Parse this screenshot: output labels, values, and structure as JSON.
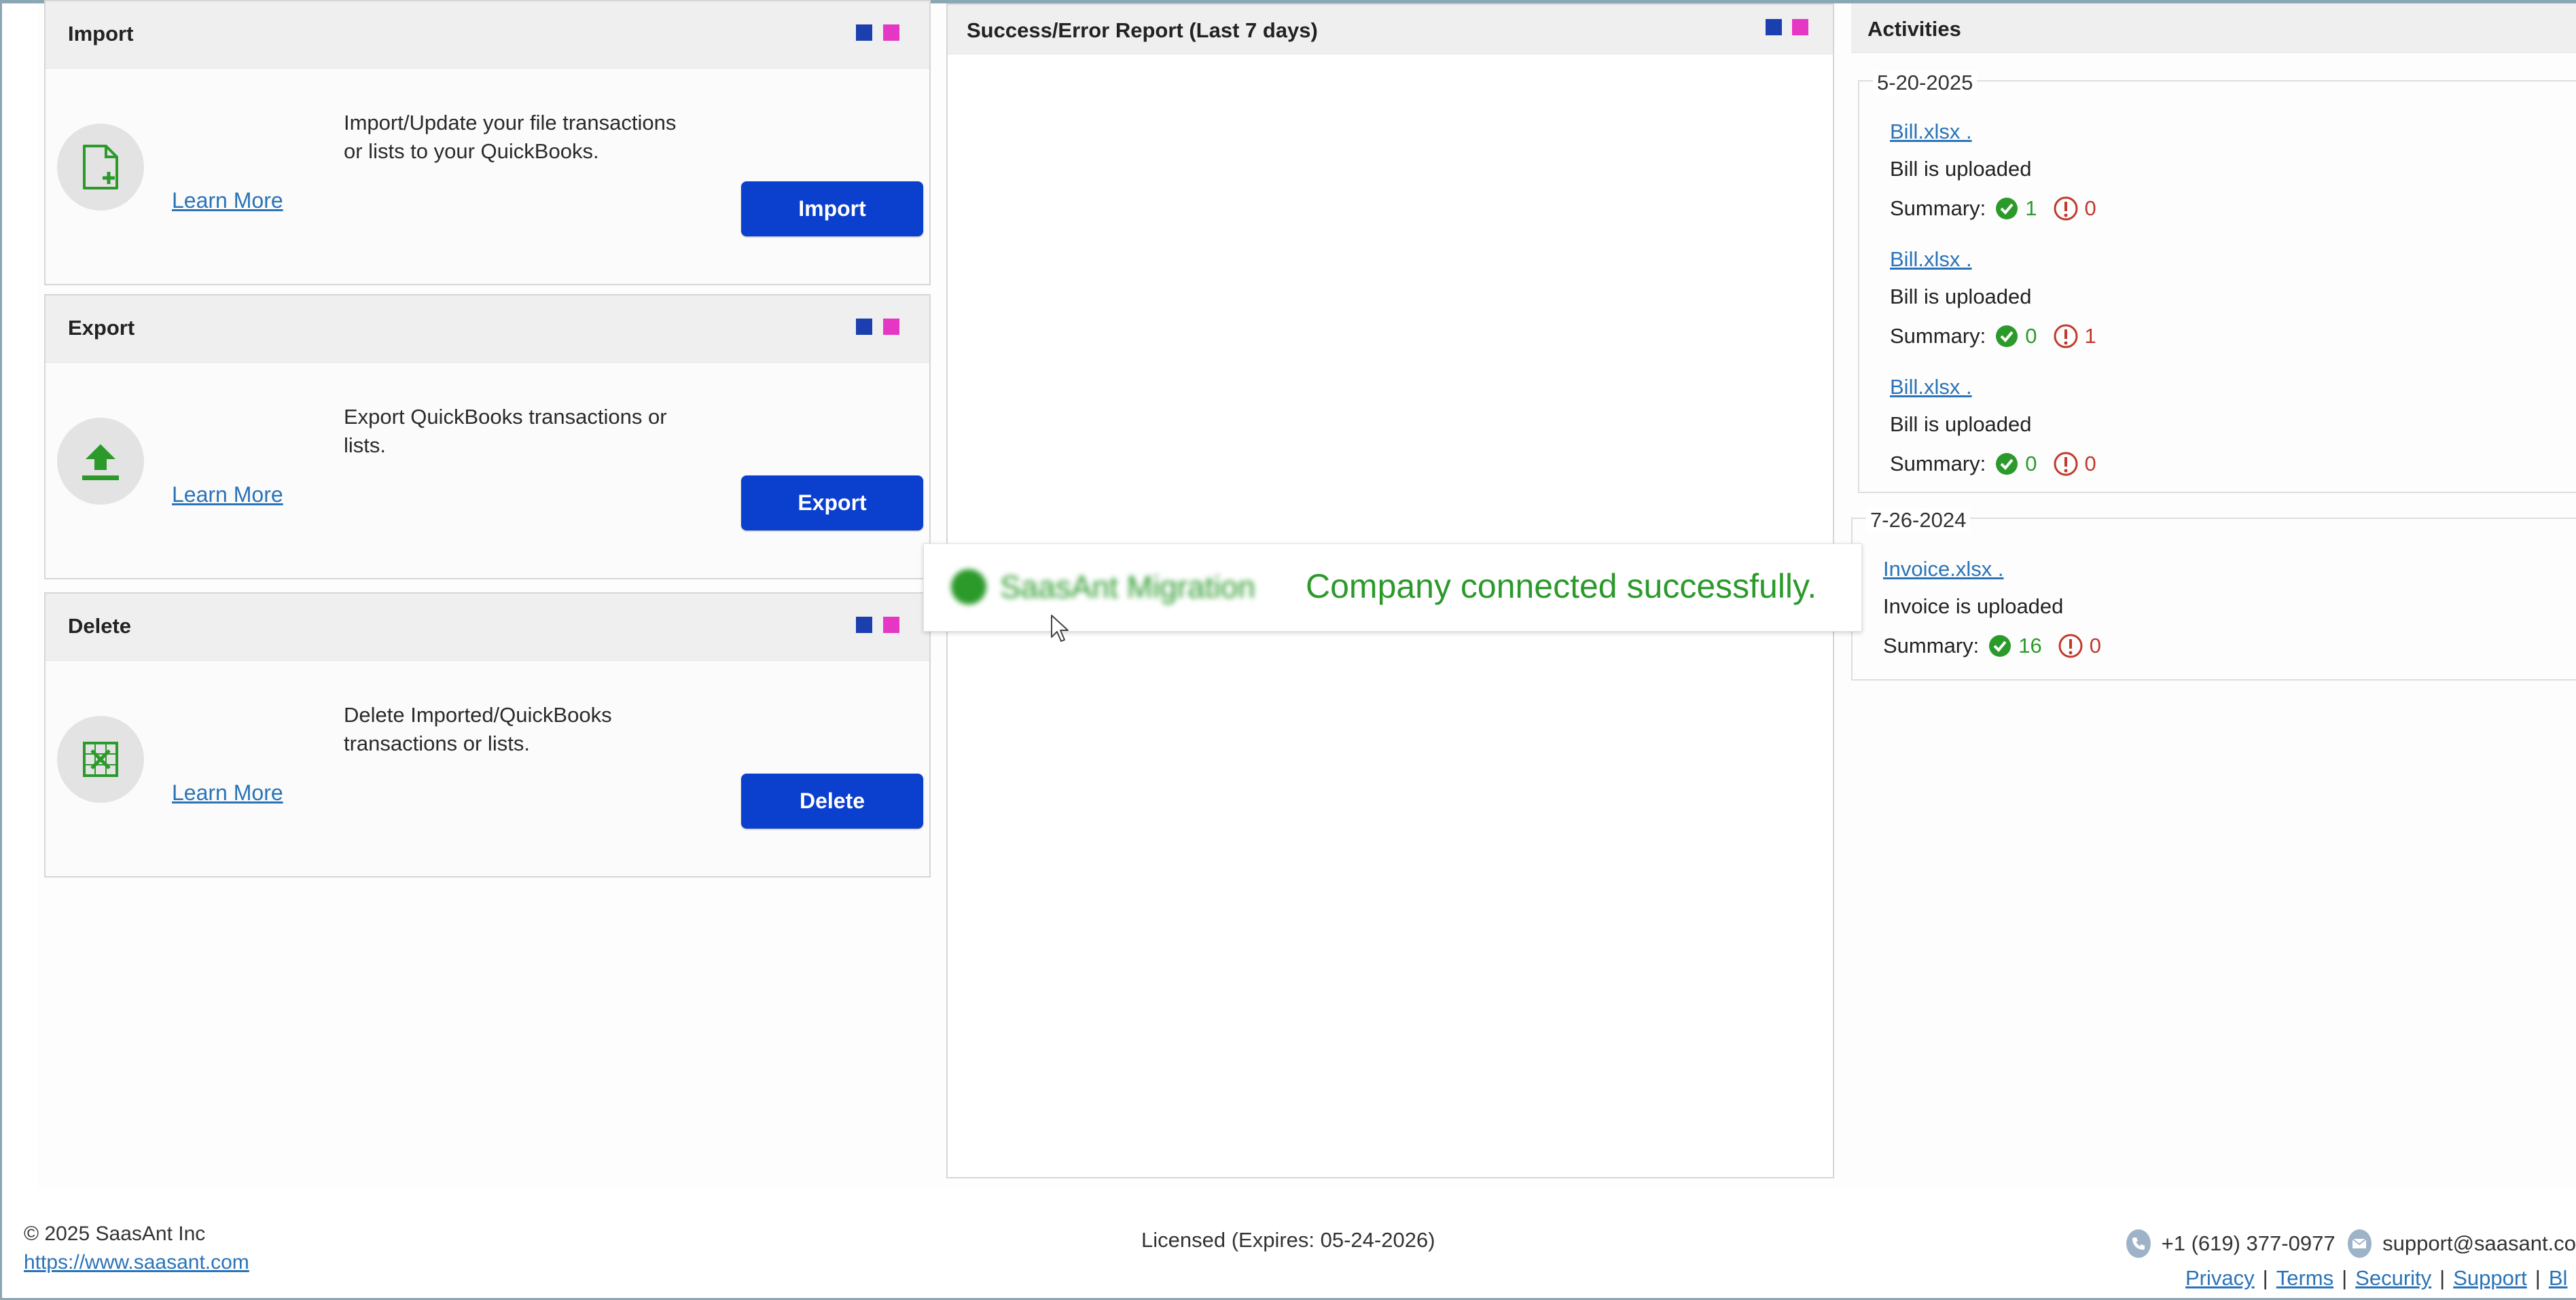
{
  "cards": [
    {
      "title": "Import",
      "description": [
        "Import/Update your file transactions",
        "or lists to your QuickBooks."
      ],
      "learn_more": "Learn More",
      "button": "Import",
      "icon": "file-plus-icon"
    },
    {
      "title": "Export",
      "description": [
        "Export QuickBooks transactions or",
        "lists."
      ],
      "learn_more": "Learn More",
      "button": "Export",
      "icon": "upload-icon"
    },
    {
      "title": "Delete",
      "description": [
        "Delete Imported/QuickBooks",
        "transactions or lists."
      ],
      "learn_more": "Learn More",
      "button": "Delete",
      "icon": "delete-grid-icon"
    }
  ],
  "report": {
    "title": "Success/Error Report (Last 7 days)"
  },
  "activities": {
    "title": "Activities",
    "summary_label": "Summary:",
    "groups": [
      {
        "date": "5-20-2025",
        "entries": [
          {
            "file": "Bill.xlsx .",
            "message": "Bill is uploaded",
            "success": "1",
            "error": "0"
          },
          {
            "file": "Bill.xlsx .",
            "message": "Bill is uploaded",
            "success": "0",
            "error": "1"
          },
          {
            "file": "Bill.xlsx .",
            "message": "Bill is uploaded",
            "success": "0",
            "error": "0"
          }
        ]
      },
      {
        "date": "7-26-2024",
        "entries": [
          {
            "file": "Invoice.xlsx .",
            "message": "Invoice is uploaded",
            "success": "16",
            "error": "0"
          }
        ]
      }
    ]
  },
  "toast": {
    "blurred_text": "SaasAnt Migration",
    "message": "Company connected successfully."
  },
  "footer": {
    "copyright": "©  2025  SaasAnt Inc",
    "website": "https://www.saasant.com",
    "license": "Licensed  (Expires: 05-24-2026)",
    "phone": "+1 (619) 377-0977",
    "email": "support@saasant.co",
    "links": [
      "Privacy",
      "Terms",
      "Security",
      "Support",
      "Bl"
    ]
  },
  "colors": {
    "primary_button": "#0b3fce",
    "success": "#2b9a2b",
    "error": "#c0392b",
    "link": "#2a73b8",
    "legend_blue": "#1b3fae",
    "legend_pink": "#e636c4"
  }
}
